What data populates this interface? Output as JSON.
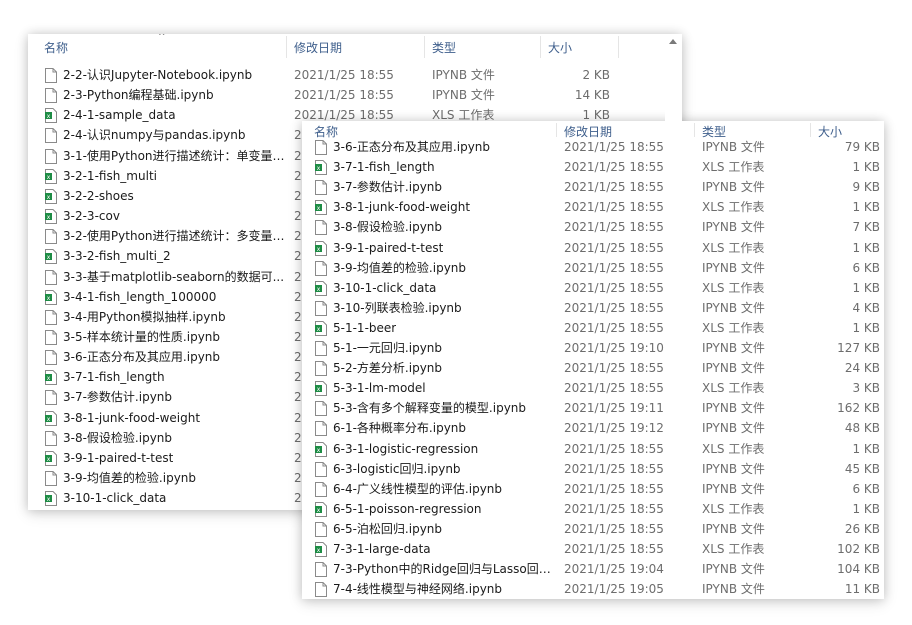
{
  "colors": {
    "header_text": "#3f5f8c",
    "meta_text": "#6d6d6d",
    "xls_icon": "#1e8c45",
    "ipynb_icon": "#8a8a8a"
  },
  "back_window": {
    "columns": {
      "name": "名称",
      "date": "修改日期",
      "type": "类型",
      "size": "大小"
    },
    "files": [
      {
        "name": "2-2-认识Jupyter-Notebook.ipynb",
        "date": "2021/1/25 18:55",
        "type": "IPYNB 文件",
        "size": "2 KB",
        "icon": "ipynb-file-icon"
      },
      {
        "name": "2-3-Python编程基础.ipynb",
        "date": "2021/1/25 18:55",
        "type": "IPYNB 文件",
        "size": "14 KB",
        "icon": "ipynb-file-icon"
      },
      {
        "name": "2-4-1-sample_data",
        "date": "2021/1/25 18:55",
        "type": "XLS 工作表",
        "size": "1 KB",
        "icon": "xls-file-icon"
      },
      {
        "name": "2-4-认识numpy与pandas.ipynb",
        "date": "2",
        "type": "",
        "size": "",
        "icon": "ipynb-file-icon"
      },
      {
        "name": "3-1-使用Python进行描述统计：单变量.i...",
        "date": "2",
        "type": "",
        "size": "",
        "icon": "ipynb-file-icon"
      },
      {
        "name": "3-2-1-fish_multi",
        "date": "2",
        "type": "",
        "size": "",
        "icon": "xls-file-icon"
      },
      {
        "name": "3-2-2-shoes",
        "date": "2",
        "type": "",
        "size": "",
        "icon": "xls-file-icon"
      },
      {
        "name": "3-2-3-cov",
        "date": "2",
        "type": "",
        "size": "",
        "icon": "xls-file-icon"
      },
      {
        "name": "3-2-使用Python进行描述统计：多变量.i...",
        "date": "2",
        "type": "",
        "size": "",
        "icon": "ipynb-file-icon"
      },
      {
        "name": "3-3-2-fish_multi_2",
        "date": "2",
        "type": "",
        "size": "",
        "icon": "xls-file-icon"
      },
      {
        "name": "3-3-基于matplotlib-seaborn的数据可...",
        "date": "2",
        "type": "",
        "size": "",
        "icon": "ipynb-file-icon"
      },
      {
        "name": "3-4-1-fish_length_100000",
        "date": "2",
        "type": "",
        "size": "",
        "icon": "xls-file-icon"
      },
      {
        "name": "3-4-用Python模拟抽样.ipynb",
        "date": "2",
        "type": "",
        "size": "",
        "icon": "ipynb-file-icon"
      },
      {
        "name": "3-5-样本统计量的性质.ipynb",
        "date": "2",
        "type": "",
        "size": "",
        "icon": "ipynb-file-icon"
      },
      {
        "name": "3-6-正态分布及其应用.ipynb",
        "date": "2",
        "type": "",
        "size": "",
        "icon": "ipynb-file-icon"
      },
      {
        "name": "3-7-1-fish_length",
        "date": "2",
        "type": "",
        "size": "",
        "icon": "xls-file-icon"
      },
      {
        "name": "3-7-参数估计.ipynb",
        "date": "2",
        "type": "",
        "size": "",
        "icon": "ipynb-file-icon"
      },
      {
        "name": "3-8-1-junk-food-weight",
        "date": "2",
        "type": "",
        "size": "",
        "icon": "xls-file-icon"
      },
      {
        "name": "3-8-假设检验.ipynb",
        "date": "2",
        "type": "",
        "size": "",
        "icon": "ipynb-file-icon"
      },
      {
        "name": "3-9-1-paired-t-test",
        "date": "2",
        "type": "",
        "size": "",
        "icon": "xls-file-icon"
      },
      {
        "name": "3-9-均值差的检验.ipynb",
        "date": "2",
        "type": "",
        "size": "",
        "icon": "ipynb-file-icon"
      },
      {
        "name": "3-10-1-click_data",
        "date": "2",
        "type": "",
        "size": "",
        "icon": "xls-file-icon"
      }
    ]
  },
  "front_window": {
    "columns": {
      "name": "名称",
      "date": "修改日期",
      "type": "类型",
      "size": "大小"
    },
    "files": [
      {
        "name": "3-6-正态分布及其应用.ipynb",
        "date": "2021/1/25 18:55",
        "type": "IPYNB 文件",
        "size": "79 KB",
        "icon": "ipynb-file-icon"
      },
      {
        "name": "3-7-1-fish_length",
        "date": "2021/1/25 18:55",
        "type": "XLS 工作表",
        "size": "1 KB",
        "icon": "xls-file-icon"
      },
      {
        "name": "3-7-参数估计.ipynb",
        "date": "2021/1/25 18:55",
        "type": "IPYNB 文件",
        "size": "9 KB",
        "icon": "ipynb-file-icon"
      },
      {
        "name": "3-8-1-junk-food-weight",
        "date": "2021/1/25 18:55",
        "type": "XLS 工作表",
        "size": "1 KB",
        "icon": "xls-file-icon"
      },
      {
        "name": "3-8-假设检验.ipynb",
        "date": "2021/1/25 18:55",
        "type": "IPYNB 文件",
        "size": "7 KB",
        "icon": "ipynb-file-icon"
      },
      {
        "name": "3-9-1-paired-t-test",
        "date": "2021/1/25 18:55",
        "type": "XLS 工作表",
        "size": "1 KB",
        "icon": "xls-file-icon"
      },
      {
        "name": "3-9-均值差的检验.ipynb",
        "date": "2021/1/25 18:55",
        "type": "IPYNB 文件",
        "size": "6 KB",
        "icon": "ipynb-file-icon"
      },
      {
        "name": "3-10-1-click_data",
        "date": "2021/1/25 18:55",
        "type": "XLS 工作表",
        "size": "1 KB",
        "icon": "xls-file-icon"
      },
      {
        "name": "3-10-列联表检验.ipynb",
        "date": "2021/1/25 18:55",
        "type": "IPYNB 文件",
        "size": "4 KB",
        "icon": "ipynb-file-icon"
      },
      {
        "name": "5-1-1-beer",
        "date": "2021/1/25 18:55",
        "type": "XLS 工作表",
        "size": "1 KB",
        "icon": "xls-file-icon"
      },
      {
        "name": "5-1-一元回归.ipynb",
        "date": "2021/1/25 19:10",
        "type": "IPYNB 文件",
        "size": "127 KB",
        "icon": "ipynb-file-icon"
      },
      {
        "name": "5-2-方差分析.ipynb",
        "date": "2021/1/25 18:55",
        "type": "IPYNB 文件",
        "size": "24 KB",
        "icon": "ipynb-file-icon"
      },
      {
        "name": "5-3-1-lm-model",
        "date": "2021/1/25 18:55",
        "type": "XLS 工作表",
        "size": "3 KB",
        "icon": "xls-file-icon"
      },
      {
        "name": "5-3-含有多个解释变量的模型.ipynb",
        "date": "2021/1/25 19:11",
        "type": "IPYNB 文件",
        "size": "162 KB",
        "icon": "ipynb-file-icon"
      },
      {
        "name": "6-1-各种概率分布.ipynb",
        "date": "2021/1/25 19:12",
        "type": "IPYNB 文件",
        "size": "48 KB",
        "icon": "ipynb-file-icon"
      },
      {
        "name": "6-3-1-logistic-regression",
        "date": "2021/1/25 18:55",
        "type": "XLS 工作表",
        "size": "1 KB",
        "icon": "xls-file-icon"
      },
      {
        "name": "6-3-logistic回归.ipynb",
        "date": "2021/1/25 18:55",
        "type": "IPYNB 文件",
        "size": "45 KB",
        "icon": "ipynb-file-icon"
      },
      {
        "name": "6-4-广义线性模型的评估.ipynb",
        "date": "2021/1/25 18:55",
        "type": "IPYNB 文件",
        "size": "6 KB",
        "icon": "ipynb-file-icon"
      },
      {
        "name": "6-5-1-poisson-regression",
        "date": "2021/1/25 18:55",
        "type": "XLS 工作表",
        "size": "1 KB",
        "icon": "xls-file-icon"
      },
      {
        "name": "6-5-泊松回归.ipynb",
        "date": "2021/1/25 18:55",
        "type": "IPYNB 文件",
        "size": "26 KB",
        "icon": "ipynb-file-icon"
      },
      {
        "name": "7-3-1-large-data",
        "date": "2021/1/25 18:55",
        "type": "XLS 工作表",
        "size": "102 KB",
        "icon": "xls-file-icon"
      },
      {
        "name": "7-3-Python中的Ridge回归与Lasso回归....",
        "date": "2021/1/25 19:04",
        "type": "IPYNB 文件",
        "size": "104 KB",
        "icon": "ipynb-file-icon"
      },
      {
        "name": "7-4-线性模型与神经网络.ipynb",
        "date": "2021/1/25 19:05",
        "type": "IPYNB 文件",
        "size": "11 KB",
        "icon": "ipynb-file-icon"
      }
    ]
  }
}
